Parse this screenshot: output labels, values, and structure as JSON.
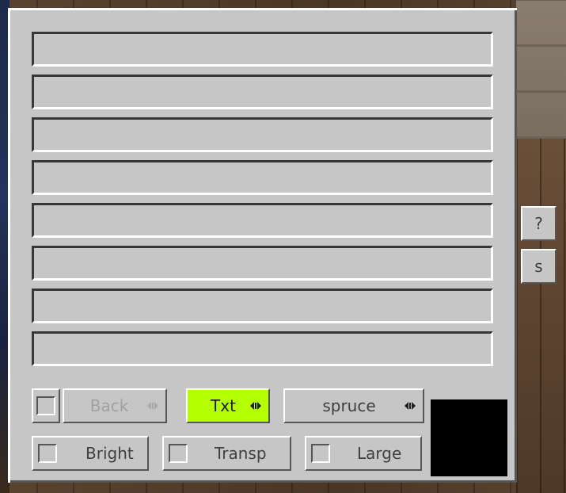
{
  "lines": [
    "",
    "",
    "",
    "",
    "",
    "",
    "",
    ""
  ],
  "buttons": {
    "back": {
      "label": "Back",
      "checked": false,
      "enabled": false
    },
    "text_mode": {
      "label": "Txt"
    },
    "wood": {
      "label": "spruce"
    },
    "bright": {
      "label": "Bright",
      "checked": false
    },
    "transp": {
      "label": "Transp",
      "checked": false
    },
    "large": {
      "label": "Large",
      "checked": false
    }
  },
  "side_buttons": {
    "help": "?",
    "s": "s"
  },
  "colors": {
    "text_mode_active": "#b4ff00",
    "swatch": "#000000"
  },
  "icons": {
    "cycle": "cycle-arrows-icon",
    "checkbox": "checkbox-icon"
  }
}
